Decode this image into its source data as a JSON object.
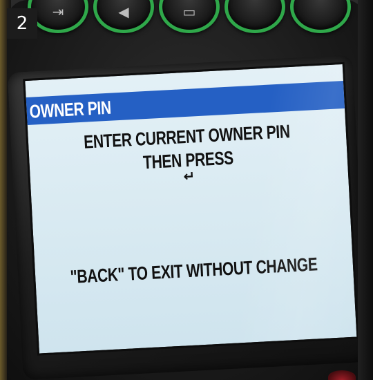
{
  "step_badge": "2",
  "keypad": {
    "keys": [
      {
        "icon": "login-icon",
        "glyph": "⇥"
      },
      {
        "icon": "back-arrow-icon",
        "glyph": "◀"
      },
      {
        "icon": "menu-icon",
        "glyph": "▭"
      },
      {
        "icon": "blank-key",
        "glyph": ""
      },
      {
        "icon": "blank-key",
        "glyph": ""
      }
    ],
    "ring_color": "#2fa84a"
  },
  "screen": {
    "title": "OWNER PIN",
    "title_bar_color": "#2560c4",
    "line1": "ENTER CURRENT OWNER PIN",
    "line2": "THEN PRESS",
    "enter_symbol": "↵",
    "line3": "\"BACK\" TO EXIT WITHOUT CHANGE"
  }
}
